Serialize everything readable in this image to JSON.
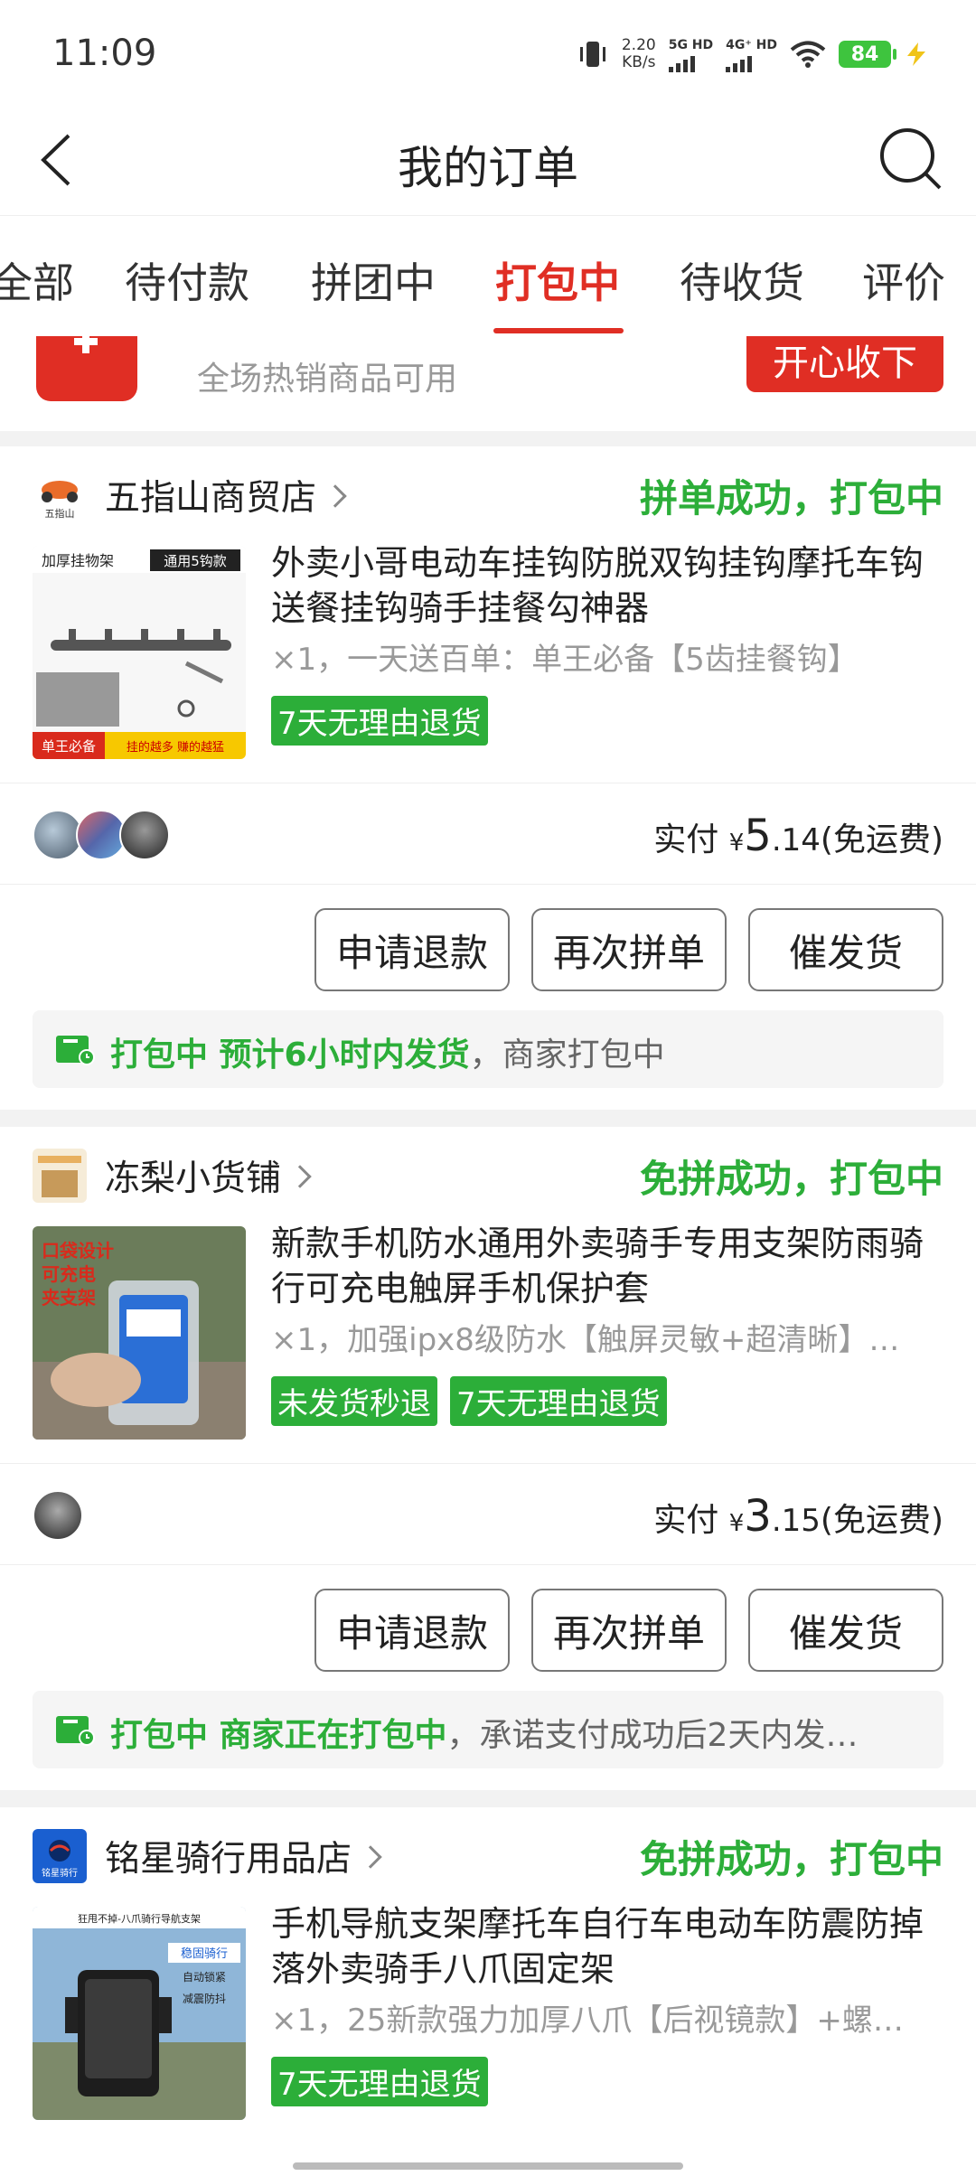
{
  "status_bar": {
    "time": "11:09",
    "net_speed_value": "2.20",
    "net_speed_unit": "KB/s",
    "sim1_label": "5G HD",
    "sim2_label": "4G⁺ HD",
    "battery": "84",
    "icons": [
      "vibrate-icon",
      "signal-icon",
      "wifi-icon",
      "battery-icon",
      "charging-icon"
    ]
  },
  "nav": {
    "title": "我的订单",
    "icons": [
      "back-arrow-icon",
      "search-icon"
    ]
  },
  "tabs": [
    {
      "label": "全部"
    },
    {
      "label": "待付款"
    },
    {
      "label": "拼团中"
    },
    {
      "label": "打包中"
    },
    {
      "label": "待收货"
    },
    {
      "label": "评价"
    }
  ],
  "active_tab": "打包中",
  "banner": {
    "text": "全场热销商品可用",
    "button_label": "开心收下"
  },
  "orders": [
    {
      "shop_name": "五指山商贸店",
      "shop_logo_text": "五指山",
      "status": "拼单成功，打包中",
      "product_title": "外卖小哥电动车挂钩防脱双钩挂钩摩托车钩送餐挂钩骑手挂餐勾神器",
      "spec": "×1，一天送百单：单王必备【5齿挂餐钩】",
      "image_texts": [
        "加厚挂物架",
        "通用5钩款",
        "单王必备",
        "挂的越多 赚的越猛"
      ],
      "tags": [
        "7天无理由退货"
      ],
      "pay_label": "实付",
      "currency": "¥",
      "amount_int": "5",
      "amount_dec": ".14",
      "shipping": "(免运费)",
      "buttons": [
        "申请退款",
        "再次拼单",
        "催发货"
      ],
      "note_green": "打包中 预计6小时内发货",
      "note_rest": "，商家打包中"
    },
    {
      "shop_name": "冻梨小货铺",
      "shop_logo_text": "",
      "status": "免拼成功，打包中",
      "product_title": "新款手机防水通用外卖骑手专用支架防雨骑行可充电触屏手机保护套",
      "spec": "×1，加强ipx8级防水【触屏灵敏+超清晰】…",
      "image_texts": [
        "口袋设计",
        "可充电",
        "夹支架"
      ],
      "tags": [
        "未发货秒退",
        "7天无理由退货"
      ],
      "pay_label": "实付",
      "currency": "¥",
      "amount_int": "3",
      "amount_dec": ".15",
      "shipping": "(免运费)",
      "buttons": [
        "申请退款",
        "再次拼单",
        "催发货"
      ],
      "note_green": "打包中 商家正在打包中",
      "note_rest": "，承诺支付成功后2天内发…"
    },
    {
      "shop_name": "铭星骑行用品店",
      "shop_logo_text": "铭星骑行",
      "status": "免拼成功，打包中",
      "product_title": "手机导航支架摩托车自行车电动车防震防掉落外卖骑手八爪固定架",
      "spec": "×1，25新款强力加厚八爪【后视镜款】+螺…",
      "image_texts": [
        "狂甩不掉-八爪骑行导航支架",
        "稳固骑行",
        "自动锁紧",
        "减震防抖"
      ],
      "tags": [
        "7天无理由退货"
      ]
    }
  ],
  "colors": {
    "accent_red": "#e02e24",
    "success_green": "#2cae39",
    "background": "#f2f2f2"
  }
}
